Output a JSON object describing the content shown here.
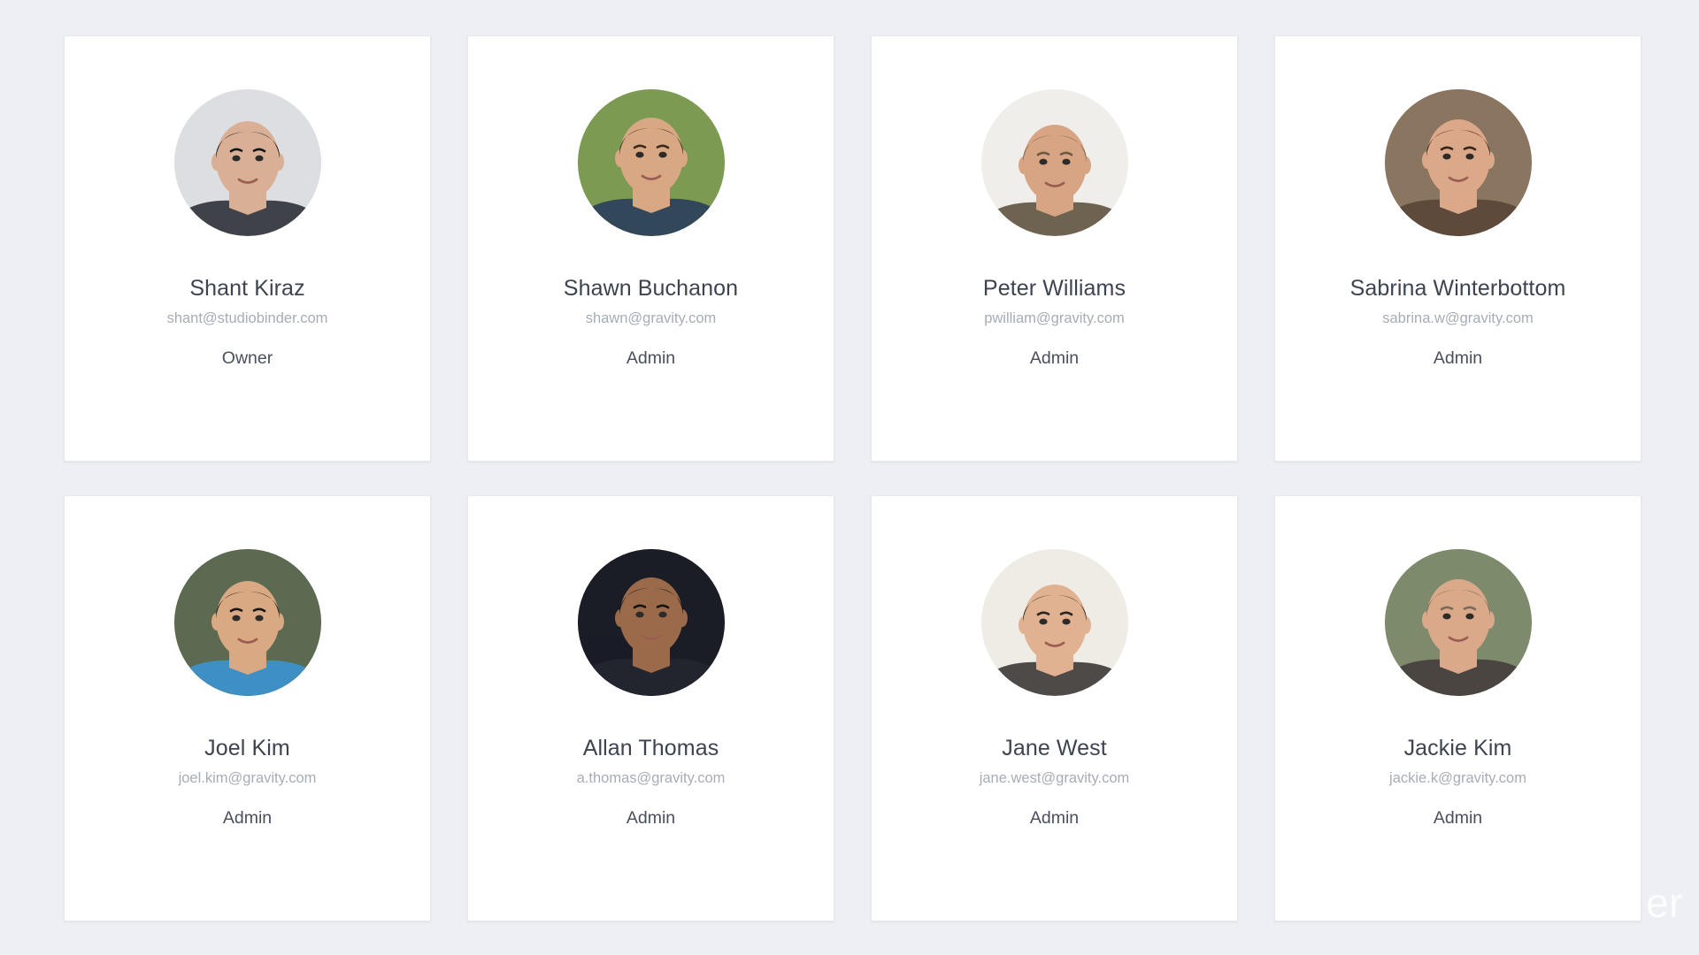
{
  "background_color": "#edeff4",
  "card": {
    "background_color": "#ffffff",
    "border_color": "#e6e8ee"
  },
  "text_colors": {
    "name": "#3d4450",
    "email": "#a7acb6",
    "role": "#4a505c"
  },
  "watermark": {
    "text": "er"
  },
  "members": [
    {
      "name": "Shant Kiraz",
      "email": "shant@studiobinder.com",
      "role": "Owner",
      "avatar": {
        "icon_name": "avatar-shant-kiraz",
        "background": "#dcdee2",
        "hair": "#15120f",
        "skin": "#d9b096",
        "clothing": "#3f4349"
      }
    },
    {
      "name": "Shawn Buchanon",
      "email": "shawn@gravity.com",
      "role": "Admin",
      "avatar": {
        "icon_name": "avatar-shawn-buchanon",
        "background": "#7d9a52",
        "hair": "#3b2a1c",
        "skin": "#d7a883",
        "clothing": "#33475a"
      }
    },
    {
      "name": "Peter Williams",
      "email": "pwilliam@gravity.com",
      "role": "Admin",
      "avatar": {
        "icon_name": "avatar-peter-williams",
        "background": "#efeeea",
        "hair": "#6d5a43",
        "skin": "#d7a584",
        "clothing": "#6d6350"
      }
    },
    {
      "name": "Sabrina Winterbottom",
      "email": "sabrina.w@gravity.com",
      "role": "Admin",
      "avatar": {
        "icon_name": "avatar-sabrina-winterbottom",
        "background": "#8a7560",
        "hair": "#3a2418",
        "skin": "#dba98a",
        "clothing": "#5d4a3a"
      }
    },
    {
      "name": "Joel Kim",
      "email": "joel.kim@gravity.com",
      "role": "Admin",
      "avatar": {
        "icon_name": "avatar-joel-kim",
        "background": "#5c6a52",
        "hair": "#1b1510",
        "skin": "#d8a982",
        "clothing": "#3d8fc4"
      }
    },
    {
      "name": "Allan Thomas",
      "email": "a.thomas@gravity.com",
      "role": "Admin",
      "avatar": {
        "icon_name": "avatar-allan-thomas",
        "background": "#1a1c26",
        "hair": "#14110f",
        "skin": "#9a6a4a",
        "clothing": "#22242e"
      }
    },
    {
      "name": "Jane West",
      "email": "jane.west@gravity.com",
      "role": "Admin",
      "avatar": {
        "icon_name": "avatar-jane-west",
        "background": "#efece6",
        "hair": "#2a2320",
        "skin": "#e0b291",
        "clothing": "#4d4a48"
      }
    },
    {
      "name": "Jackie Kim",
      "email": "jackie.k@gravity.com",
      "role": "Admin",
      "avatar": {
        "icon_name": "avatar-jackie-kim",
        "background": "#7e8a6c",
        "hair": "#7d6a5a",
        "skin": "#d9a98a",
        "clothing": "#4a4540"
      }
    }
  ]
}
